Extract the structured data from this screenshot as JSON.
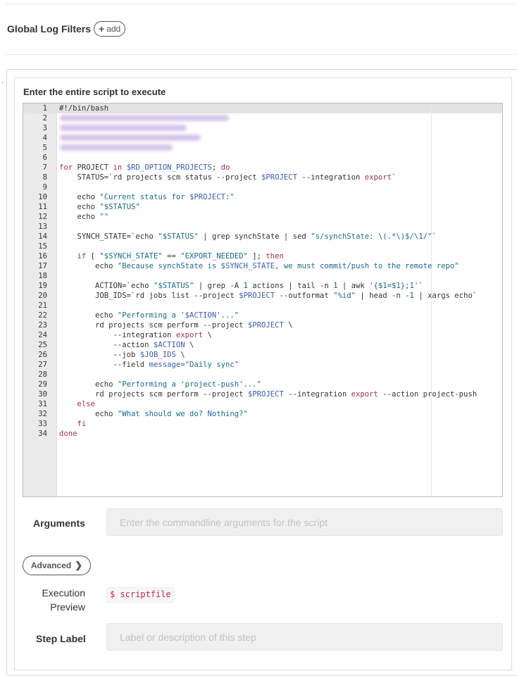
{
  "global_log_filters": {
    "title": "Global Log Filters",
    "add_label": "add"
  },
  "script": {
    "label": "Enter the entire script to execute",
    "lines": [
      {
        "n": "1",
        "tokens": [
          [
            "#!/bin/bash",
            ""
          ]
        ]
      },
      {
        "n": "2",
        "tokens": []
      },
      {
        "n": "3",
        "tokens": []
      },
      {
        "n": "4",
        "tokens": []
      },
      {
        "n": "5",
        "tokens": []
      },
      {
        "n": "6",
        "tokens": []
      },
      {
        "n": "7",
        "tokens": [
          [
            "for",
            "kw"
          ],
          [
            " PROJECT ",
            ""
          ],
          [
            "in",
            "kw"
          ],
          [
            " ",
            ""
          ],
          [
            "$RD_OPTION_PROJECTS",
            "var"
          ],
          [
            "; ",
            ""
          ],
          [
            "do",
            "kw"
          ]
        ]
      },
      {
        "n": "8",
        "tokens": [
          [
            "    STATUS=`rd projects scm status --project ",
            ""
          ],
          [
            "$PROJECT",
            "var"
          ],
          [
            " --integration ",
            ""
          ],
          [
            "export",
            "kw"
          ],
          [
            "`",
            ""
          ]
        ]
      },
      {
        "n": "9",
        "tokens": []
      },
      {
        "n": "10",
        "tokens": [
          [
            "    echo ",
            ""
          ],
          [
            "\"Current status for ",
            "str"
          ],
          [
            "$PROJECT",
            "var"
          ],
          [
            ":\"",
            "str"
          ]
        ]
      },
      {
        "n": "11",
        "tokens": [
          [
            "    echo ",
            ""
          ],
          [
            "\"$STATUS\"",
            "str"
          ]
        ]
      },
      {
        "n": "12",
        "tokens": [
          [
            "    echo ",
            ""
          ],
          [
            "\"\"",
            "str"
          ]
        ]
      },
      {
        "n": "13",
        "tokens": []
      },
      {
        "n": "14",
        "tokens": [
          [
            "    SYNCH_STATE=`echo ",
            ""
          ],
          [
            "\"$STATUS\"",
            "str"
          ],
          [
            " | grep synchState | sed ",
            ""
          ],
          [
            "\"s/synchState: \\(.*\\)$/\\1/\"",
            "str"
          ],
          [
            "`",
            ""
          ]
        ]
      },
      {
        "n": "15",
        "tokens": []
      },
      {
        "n": "16",
        "tokens": [
          [
            "    ",
            ""
          ],
          [
            "if",
            "kw"
          ],
          [
            " [ ",
            ""
          ],
          [
            "\"$SYNCH_STATE\"",
            "str"
          ],
          [
            " == ",
            ""
          ],
          [
            "\"EXPORT_NEEDED\"",
            "str"
          ],
          [
            " ]; ",
            ""
          ],
          [
            "then",
            "kw"
          ]
        ]
      },
      {
        "n": "17",
        "tokens": [
          [
            "        echo ",
            ""
          ],
          [
            "\"Because synchState is ",
            "str"
          ],
          [
            "$SYNCH_STATE",
            "var"
          ],
          [
            ", we must commit/push to the remote repo\"",
            "str"
          ]
        ]
      },
      {
        "n": "18",
        "tokens": []
      },
      {
        "n": "19",
        "tokens": [
          [
            "        ACTION=`echo ",
            ""
          ],
          [
            "\"$STATUS\"",
            "str"
          ],
          [
            " | grep -A ",
            ""
          ],
          [
            "1",
            "num"
          ],
          [
            " actions | tail -n ",
            ""
          ],
          [
            "1",
            "num"
          ],
          [
            " | awk ",
            ""
          ],
          [
            "'{$1=$1};1'",
            "str"
          ],
          [
            "`",
            ""
          ]
        ]
      },
      {
        "n": "20",
        "tokens": [
          [
            "        JOB_IDS=`rd jobs list --project ",
            ""
          ],
          [
            "$PROJECT",
            "var"
          ],
          [
            " --outformat ",
            ""
          ],
          [
            "\"%id\"",
            "str"
          ],
          [
            " | head -n -",
            ""
          ],
          [
            "1",
            "num"
          ],
          [
            " | xargs echo`",
            ""
          ]
        ]
      },
      {
        "n": "21",
        "tokens": []
      },
      {
        "n": "22",
        "tokens": [
          [
            "        echo ",
            ""
          ],
          [
            "\"Performing a '",
            "str"
          ],
          [
            "$ACTION",
            "var"
          ],
          [
            "'...\"",
            "str"
          ]
        ]
      },
      {
        "n": "23",
        "tokens": [
          [
            "        rd projects scm perform --project ",
            ""
          ],
          [
            "$PROJECT",
            "var"
          ],
          [
            " \\",
            ""
          ]
        ]
      },
      {
        "n": "24",
        "tokens": [
          [
            "            --integration ",
            ""
          ],
          [
            "export",
            "kw"
          ],
          [
            " \\",
            ""
          ]
        ]
      },
      {
        "n": "25",
        "tokens": [
          [
            "            --action ",
            ""
          ],
          [
            "$ACTION",
            "var"
          ],
          [
            " \\",
            ""
          ]
        ]
      },
      {
        "n": "26",
        "tokens": [
          [
            "            --job ",
            ""
          ],
          [
            "$JOB_IDS",
            "var"
          ],
          [
            " \\",
            ""
          ]
        ]
      },
      {
        "n": "27",
        "tokens": [
          [
            "            --field ",
            ""
          ],
          [
            "message=",
            "var"
          ],
          [
            "\"Daily sync\"",
            "str"
          ]
        ]
      },
      {
        "n": "28",
        "tokens": []
      },
      {
        "n": "29",
        "tokens": [
          [
            "        echo ",
            ""
          ],
          [
            "\"Performing a 'project-push'...\"",
            "str"
          ]
        ]
      },
      {
        "n": "30",
        "tokens": [
          [
            "        rd projects scm perform --project ",
            ""
          ],
          [
            "$PROJECT",
            "var"
          ],
          [
            " --integration ",
            ""
          ],
          [
            "export",
            "kw"
          ],
          [
            " --action project-push",
            ""
          ]
        ]
      },
      {
        "n": "31",
        "tokens": [
          [
            "    ",
            ""
          ],
          [
            "else",
            "kw"
          ]
        ]
      },
      {
        "n": "32",
        "tokens": [
          [
            "        echo ",
            ""
          ],
          [
            "\"What should we do? Nothing?\"",
            "str"
          ]
        ]
      },
      {
        "n": "33",
        "tokens": [
          [
            "    ",
            ""
          ],
          [
            "fi",
            "kw"
          ]
        ]
      },
      {
        "n": "34",
        "tokens": [
          [
            "done",
            "kw"
          ]
        ]
      }
    ]
  },
  "arguments": {
    "label": "Arguments",
    "placeholder": "Enter the commandline arguments for the script"
  },
  "advanced": {
    "label": "Advanced"
  },
  "execution_preview": {
    "label_line1": "Execution",
    "label_line2": "Preview",
    "value": "$ scriptfile"
  },
  "step_label": {
    "label": "Step Label",
    "placeholder": "Label or description of this step"
  }
}
